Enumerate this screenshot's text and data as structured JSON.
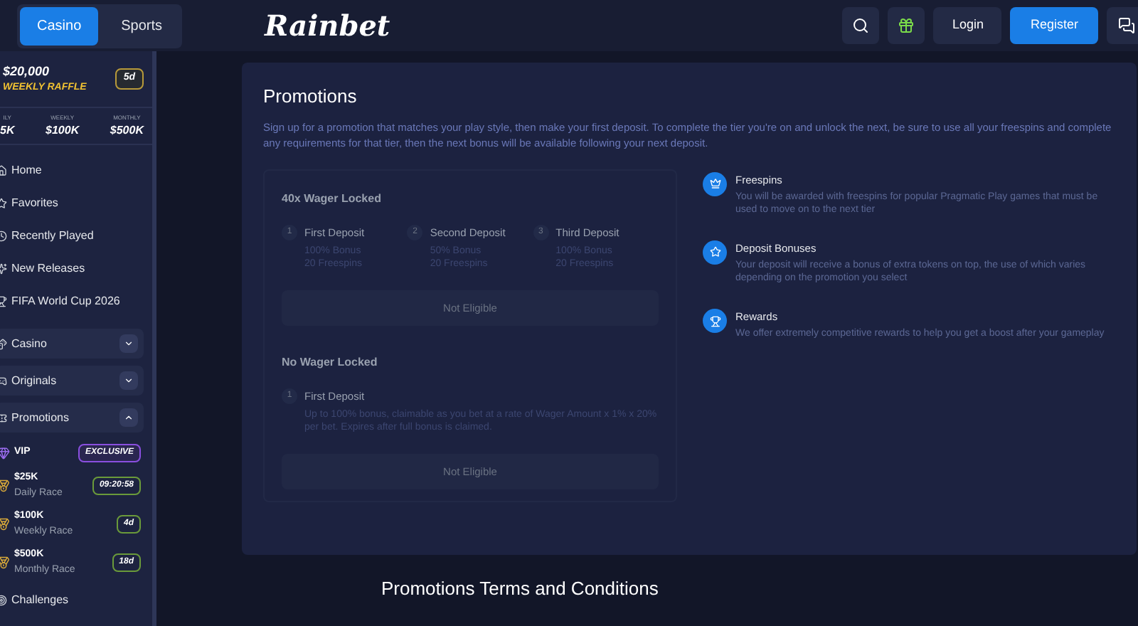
{
  "header": {
    "tabs": [
      {
        "label": "Casino",
        "selected": true
      },
      {
        "label": "Sports",
        "selected": false
      }
    ],
    "logo": "Rainbet",
    "buttons": [
      {
        "label": "Login",
        "kind": "secondary"
      },
      {
        "label": "Register",
        "kind": "primary"
      }
    ]
  },
  "sidebar": {
    "raffle": {
      "amount": "$20,000",
      "label": "WEEKLY RAFFLE",
      "badge": "5d"
    },
    "races": [
      {
        "label": "ILY",
        "amount": "5K"
      },
      {
        "label": "WEEKLY",
        "amount": "$100K"
      },
      {
        "label": "MONTHLY",
        "amount": "$500K"
      }
    ],
    "items": [
      {
        "label": "Home"
      },
      {
        "label": "Favorites"
      },
      {
        "label": "Recently Played"
      },
      {
        "label": "New Releases"
      },
      {
        "label": "FIFA World Cup 2026"
      }
    ],
    "sections": [
      {
        "label": "Casino",
        "expanded": false
      },
      {
        "label": "Originals",
        "expanded": false
      },
      {
        "label": "Promotions",
        "expanded": true
      }
    ],
    "promotions": [
      {
        "kind": "vip",
        "title": "VIP",
        "badge": "EXCLUSIVE"
      },
      {
        "kind": "race",
        "title": "$25K",
        "subtitle": "Daily Race",
        "badge": "09:20:58"
      },
      {
        "kind": "race",
        "title": "$100K",
        "subtitle": "Weekly Race",
        "badge": "4d"
      },
      {
        "kind": "race",
        "title": "$500K",
        "subtitle": "Monthly Race",
        "badge": "18d"
      }
    ],
    "footer_item": "Challenges"
  },
  "promotions": {
    "title": "Promotions",
    "description": "Sign up for a promotion that matches your play style, then make your first deposit. To complete the tier you're on and unlock the next, be sure to use all your freespins and complete any requirements for that tier, then the next bonus will be available following your next deposit.",
    "offers": [
      {
        "title": "40x Wager Locked",
        "steps": [
          {
            "number": "1",
            "title": "First Deposit",
            "lines": [
              "100% Bonus",
              "20 Freespins"
            ]
          },
          {
            "number": "2",
            "title": "Second Deposit",
            "lines": [
              "50% Bonus",
              "20 Freespins"
            ]
          },
          {
            "number": "3",
            "title": "Third Deposit",
            "lines": [
              "100% Bonus",
              "20 Freespins"
            ]
          }
        ],
        "button": "Not Eligible"
      },
      {
        "title": "No Wager Locked",
        "steps": [
          {
            "number": "1",
            "title": "First Deposit",
            "lines": [
              "Up to 100% bonus, claimable as you bet at a rate of Wager Amount x 1% x 20% per bet. Expires after full bonus is claimed."
            ]
          }
        ],
        "button": "Not Eligible"
      }
    ],
    "features": [
      {
        "kind": "crown",
        "title": "Freespins",
        "text": "You will be awarded with freespins for popular Pragmatic Play games that must be used to move on to the next tier"
      },
      {
        "kind": "star",
        "title": "Deposit Bonuses",
        "text": "Your deposit will receive a bonus of extra tokens on top, the use of which varies depending on the promotion you select"
      },
      {
        "kind": "trophy",
        "title": "Rewards",
        "text": "We offer extremely competitive rewards to help you get a boost after your gameplay"
      }
    ]
  },
  "terms_title": "Promotions Terms and Conditions"
}
